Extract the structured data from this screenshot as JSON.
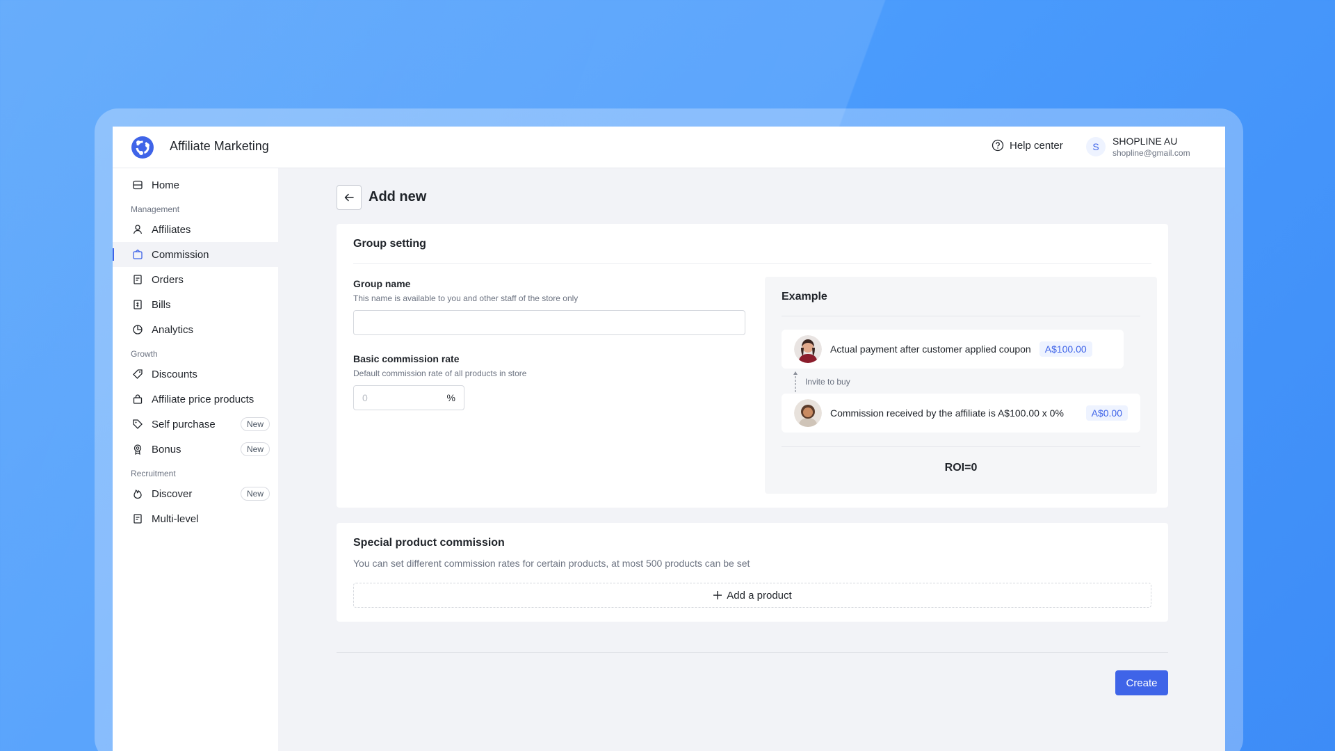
{
  "header": {
    "app_title": "Affiliate Marketing",
    "help_label": "Help center",
    "user_initial": "S",
    "user_name": "SHOPLINE AU",
    "user_email": "shopline@gmail.com"
  },
  "sidebar": {
    "items": [
      {
        "label": "Home",
        "icon": "home-icon"
      },
      {
        "label": "Affiliates",
        "icon": "user-icon"
      },
      {
        "label": "Commission",
        "icon": "wallet-icon",
        "active": true
      },
      {
        "label": "Orders",
        "icon": "document-icon"
      },
      {
        "label": "Bills",
        "icon": "bill-icon"
      },
      {
        "label": "Analytics",
        "icon": "pie-chart-icon"
      },
      {
        "label": "Discounts",
        "icon": "tag-icon"
      },
      {
        "label": "Affiliate price products",
        "icon": "bag-icon"
      },
      {
        "label": "Self purchase",
        "icon": "price-tag-icon",
        "badge": "New"
      },
      {
        "label": "Bonus",
        "icon": "medal-icon",
        "badge": "New"
      },
      {
        "label": "Discover",
        "icon": "flame-icon",
        "badge": "New"
      },
      {
        "label": "Multi-level",
        "icon": "document-icon"
      }
    ],
    "sections": {
      "management": "Management",
      "growth": "Growth",
      "recruitment": "Recruitment"
    }
  },
  "page": {
    "title": "Add new"
  },
  "group_setting": {
    "title": "Group setting",
    "group_name_label": "Group name",
    "group_name_help": "This name is available to you and other staff of the store only",
    "group_name_value": "",
    "rate_label": "Basic commission rate",
    "rate_help": "Default commission rate of all products in store",
    "rate_placeholder": "0",
    "rate_suffix": "%"
  },
  "example": {
    "title": "Example",
    "row1_text": "Actual payment after customer applied coupon",
    "row1_amount": "A$100.00",
    "invite_text": "Invite to buy",
    "row2_text": "Commission received by the affiliate is A$100.00 x 0%",
    "row2_amount": "A$0.00",
    "roi": "ROI=0"
  },
  "special": {
    "title": "Special product commission",
    "description": "You can set different commission rates for certain products, at most 500 products can be set",
    "add_label": "Add a product"
  },
  "footer": {
    "create_label": "Create"
  },
  "colors": {
    "accent": "#3f64e8",
    "background": "#4a9bfc"
  }
}
